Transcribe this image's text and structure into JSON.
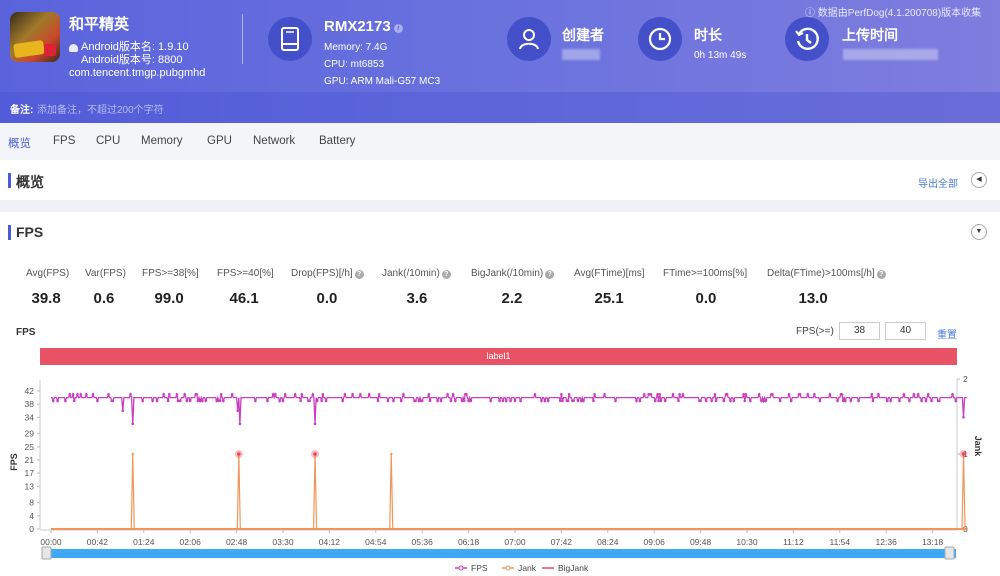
{
  "app": {
    "name": "和平精英",
    "android_version_name": "Android版本名: 1.9.10",
    "android_version_code": "Android版本号: 8800",
    "package": "com.tencent.tmgp.pubgmhd",
    "icon": "app-icon"
  },
  "device": {
    "model": "RMX2173",
    "memory": "Memory: 7.4G",
    "cpu": "CPU: mt6853",
    "gpu": "GPU: ARM Mali-G57 MC3",
    "icon": "tablet-icon"
  },
  "creator": {
    "title": "创建者",
    "value": "",
    "icon": "user-icon"
  },
  "duration": {
    "title": "时长",
    "value": "0h 13m 49s",
    "icon": "clock-icon"
  },
  "upload": {
    "title": "上传时间",
    "value": "",
    "icon": "history-icon"
  },
  "perfdog_note": "数据由PerfDog(4.1.200708)版本收集",
  "note": {
    "label": "备注:",
    "placeholder": "添加备注，不超过200个字符"
  },
  "tabs": [
    {
      "label": "概览",
      "active": true
    },
    {
      "label": "FPS"
    },
    {
      "label": "CPU"
    },
    {
      "label": "Memory"
    },
    {
      "label": "GPU"
    },
    {
      "label": "Network"
    },
    {
      "label": "Battery"
    }
  ],
  "overview": {
    "title": "概览",
    "export_label": "导出全部"
  },
  "fps_section": {
    "title": "FPS",
    "stats": [
      {
        "label": "Avg(FPS)",
        "value": "39.8",
        "help": false
      },
      {
        "label": "Var(FPS)",
        "value": "0.6",
        "help": false
      },
      {
        "label": "FPS>=38[%]",
        "value": "99.0",
        "help": false
      },
      {
        "label": "FPS>=40[%]",
        "value": "46.1",
        "help": false
      },
      {
        "label": "Drop(FPS)[/h]",
        "value": "0.0",
        "help": true
      },
      {
        "label": "Jank(/10min)",
        "value": "3.6",
        "help": true
      },
      {
        "label": "BigJank(/10min)",
        "value": "2.2",
        "help": true
      },
      {
        "label": "Avg(FTime)[ms]",
        "value": "25.1",
        "help": false
      },
      {
        "label": "FTime>=100ms[%]",
        "value": "0.0",
        "help": false
      },
      {
        "label": "Delta(FTime)>100ms[/h]",
        "value": "13.0",
        "help": true
      }
    ],
    "chart_title": "FPS",
    "threshold_label": "FPS(>=)",
    "threshold_1": "38",
    "threshold_2": "40",
    "reset_label": "重置",
    "band_label": "label1"
  },
  "chart_data": {
    "type": "line",
    "title": "FPS",
    "xlabel": "",
    "ylabel": "FPS",
    "y2label": "Jank",
    "x_ticks": [
      "00:00",
      "00:42",
      "01:24",
      "02:06",
      "02:48",
      "03:30",
      "04:12",
      "04:54",
      "05:36",
      "06:18",
      "07:00",
      "07:42",
      "08:24",
      "09:06",
      "09:48",
      "10:30",
      "11:12",
      "11:54",
      "12:36",
      "13:18"
    ],
    "y_ticks": [
      0,
      4,
      8,
      13,
      17,
      21,
      25,
      29,
      34,
      38,
      42
    ],
    "y2_ticks": [
      0,
      1,
      2
    ],
    "ylim": [
      0,
      42
    ],
    "y2lim": [
      0,
      2
    ],
    "xlim_seconds": [
      0,
      829
    ],
    "legend": [
      "FPS",
      "Jank",
      "BigJank"
    ],
    "legend_position": "bottom-center",
    "series": [
      {
        "name": "FPS",
        "color": "#c93fbf",
        "baseline": 40,
        "alt_values": [
          39,
          41
        ],
        "dips": [
          {
            "t": 65,
            "v": 36
          },
          {
            "t": 74,
            "v": 32
          },
          {
            "t": 169,
            "v": 36
          },
          {
            "t": 171,
            "v": 32
          },
          {
            "t": 237,
            "v": 41
          },
          {
            "t": 239,
            "v": 32
          },
          {
            "t": 826,
            "v": 34
          }
        ]
      },
      {
        "name": "Jank",
        "color": "#f0965a",
        "points": [
          {
            "t": 74,
            "v": 1
          },
          {
            "t": 170,
            "v": 1
          },
          {
            "t": 239,
            "v": 1
          },
          {
            "t": 308,
            "v": 1
          },
          {
            "t": 826,
            "v": 1
          }
        ]
      },
      {
        "name": "BigJank",
        "color": "#e84a5a",
        "points": [
          {
            "t": 170,
            "v": 1
          },
          {
            "t": 239,
            "v": 1
          },
          {
            "t": 826,
            "v": 1
          }
        ]
      }
    ]
  },
  "colors": {
    "header_start": "#5a63dc",
    "accent": "#4a5bd6",
    "band": "#e95366",
    "fps": "#c93fbf",
    "jank": "#f0965a",
    "bigjank": "#e84a5a",
    "slider": "#3fa9f5"
  }
}
